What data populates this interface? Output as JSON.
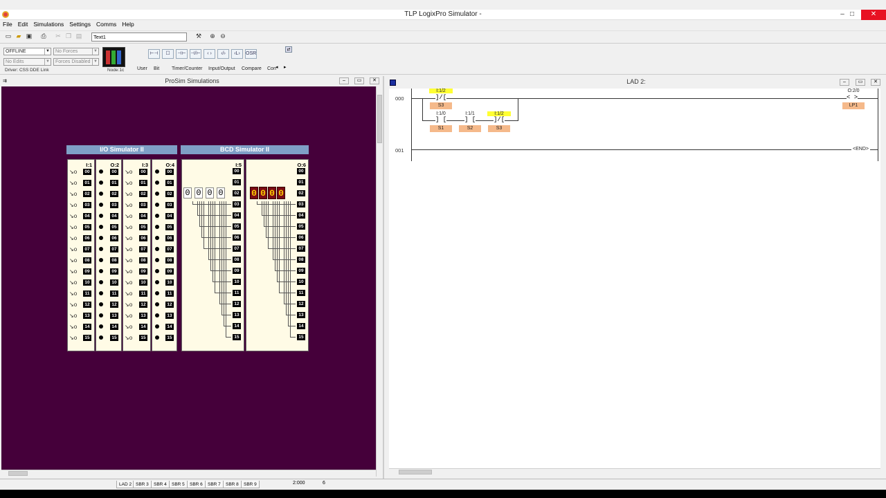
{
  "app": {
    "title": "TLP LogixPro Simulator  -",
    "controls": {
      "minimize": "–",
      "maximize": "□",
      "close": "✕"
    }
  },
  "menu": [
    "File",
    "Edit",
    "Simulations",
    "Settings",
    "Comms",
    "Help"
  ],
  "toolbar": {
    "text_field": "Text1"
  },
  "status": {
    "mode": "OFFLINE",
    "forces": "No Forces",
    "edits": "No Edits",
    "forces_enabled": "Forces Disabled",
    "driver": "Driver: CSS DDE Link",
    "node": "Node:1c"
  },
  "palette": {
    "buttons": [
      "⊢⊣",
      "☐",
      "⊣⊢",
      "⊣/⊢",
      "‹ ›",
      "‹/›",
      "‹L›",
      "OSR"
    ],
    "tabs": [
      "User",
      "Bit",
      "Timer/Counter",
      "Input/Output",
      "Compare",
      "Con"
    ]
  },
  "prosim": {
    "title": "ProSim Simulations",
    "io_sim_title": "I/O Simulator II",
    "bcd_sim_title": "BCD Simulator II",
    "io_columns": [
      "I:1",
      "O:2",
      "I:3",
      "O:4"
    ],
    "bcd_columns": [
      "I:5",
      "O:6"
    ],
    "bits": [
      "00",
      "01",
      "02",
      "03",
      "04",
      "05",
      "06",
      "07",
      "08",
      "09",
      "10",
      "11",
      "12",
      "13",
      "14",
      "15"
    ],
    "switch_glyph": "↘o",
    "bcd_input_digits": [
      "0",
      "0",
      "0",
      "0"
    ],
    "bcd_output_digits": [
      "0",
      "0",
      "0",
      "0"
    ]
  },
  "ladder": {
    "title": "LAD 2:",
    "rungs": [
      {
        "number": "000",
        "branch1": [
          {
            "address": "I:1/2",
            "symbol": "S3",
            "type": "XIO",
            "highlight": true
          }
        ],
        "branch2": [
          {
            "address": "I:1/0",
            "symbol": "S1",
            "type": "XIC",
            "highlight": false
          },
          {
            "address": "I:1/1",
            "symbol": "S2",
            "type": "XIC",
            "highlight": false
          },
          {
            "address": "I:1/2",
            "symbol": "S3",
            "type": "XIO",
            "highlight": true
          }
        ],
        "output": {
          "address": "O:2/0",
          "symbol": "LP1"
        }
      },
      {
        "number": "001",
        "end": "END"
      }
    ]
  },
  "bottom": {
    "tabs": [
      "LAD 2",
      "SBR 3",
      "SBR 4",
      "SBR 5",
      "SBR 6",
      "SBR 7",
      "SBR 8",
      "SBR 9"
    ],
    "field1": "2:000",
    "field2": "6"
  },
  "colors": {
    "prosim_bg": "#45003a",
    "sim_header": "#7f9fc6",
    "highlight": "#ffff33",
    "symbol": "#f5b98a",
    "led": "#ffcc00"
  }
}
